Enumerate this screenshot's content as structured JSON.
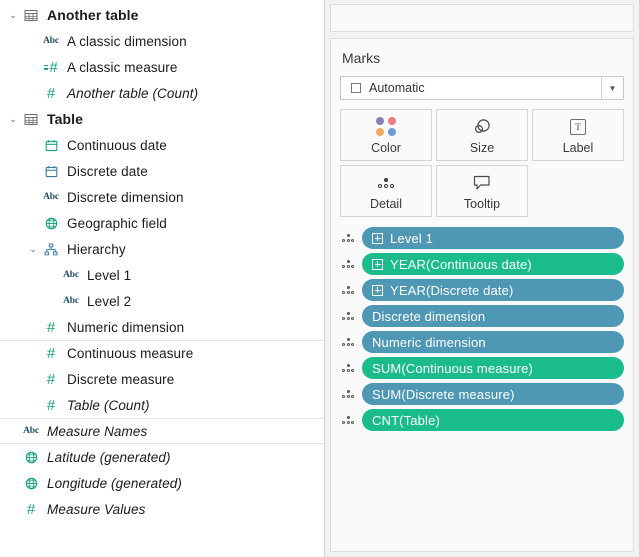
{
  "colors": {
    "pill_blue": "#4e97b5",
    "pill_green": "#1abc8b",
    "icon_green": "#17a07e",
    "icon_blue": "#3b7ea1",
    "text": "#1b1b1b"
  },
  "data_pane": {
    "groups": [
      {
        "name": "Another table",
        "icon": "table-icon",
        "expanded": true,
        "fields": [
          {
            "label": "A classic dimension",
            "icon": "abc-icon",
            "italic": false,
            "indent": 2
          },
          {
            "label": "A classic measure",
            "icon": "continuous-number-icon",
            "italic": false,
            "indent": 2
          },
          {
            "label": "Another table (Count)",
            "icon": "number-icon",
            "italic": true,
            "indent": 2
          }
        ]
      },
      {
        "name": "Table",
        "icon": "table-icon",
        "expanded": true,
        "fields": [
          {
            "label": "Continuous date",
            "icon": "calendar-green-icon",
            "italic": false,
            "indent": 2
          },
          {
            "label": "Discrete date",
            "icon": "calendar-blue-icon",
            "italic": false,
            "indent": 2
          },
          {
            "label": "Discrete dimension",
            "icon": "abc-icon",
            "italic": false,
            "indent": 2
          },
          {
            "label": "Geographic field",
            "icon": "globe-icon",
            "italic": false,
            "indent": 2
          },
          {
            "label": "Hierarchy",
            "icon": "hierarchy-icon",
            "italic": false,
            "indent": 2,
            "expandable": true,
            "expanded": true
          },
          {
            "label": "Level 1",
            "icon": "abc-icon",
            "italic": false,
            "indent": 3
          },
          {
            "label": "Level 2",
            "icon": "abc-icon",
            "italic": false,
            "indent": 3
          },
          {
            "label": "Numeric dimension",
            "icon": "number-icon",
            "italic": false,
            "indent": 2
          },
          {
            "label": "Continuous measure",
            "icon": "number-icon",
            "italic": false,
            "indent": 2,
            "divider_above": true
          },
          {
            "label": "Discrete measure",
            "icon": "number-icon",
            "italic": false,
            "indent": 2
          },
          {
            "label": "Table (Count)",
            "icon": "number-icon",
            "italic": true,
            "indent": 2
          }
        ]
      }
    ],
    "generated": [
      {
        "label": "Measure Names",
        "icon": "abc-icon",
        "italic": true,
        "divider_below": true
      },
      {
        "label": "Latitude (generated)",
        "icon": "globe-icon",
        "italic": true
      },
      {
        "label": "Longitude (generated)",
        "icon": "globe-icon",
        "italic": true
      },
      {
        "label": "Measure Values",
        "icon": "number-icon",
        "italic": true
      }
    ]
  },
  "marks": {
    "title": "Marks",
    "mark_type": {
      "value": "Automatic",
      "icon": "square-outline-icon",
      "caret": "chevron-down-icon"
    },
    "properties": [
      {
        "label": "Color",
        "icon": "color-dots-icon"
      },
      {
        "label": "Size",
        "icon": "size-circles-icon"
      },
      {
        "label": "Label",
        "icon": "label-text-icon"
      },
      {
        "label": "Detail",
        "icon": "detail-dots-icon"
      },
      {
        "label": "Tooltip",
        "icon": "tooltip-bubble-icon"
      }
    ],
    "pills": [
      {
        "label": "Level 1",
        "color": "blue",
        "expand": true
      },
      {
        "label": "YEAR(Continuous date)",
        "color": "green",
        "expand": true
      },
      {
        "label": "YEAR(Discrete date)",
        "color": "blue",
        "expand": true
      },
      {
        "label": "Discrete dimension",
        "color": "blue",
        "expand": false
      },
      {
        "label": "Numeric dimension",
        "color": "blue",
        "expand": false
      },
      {
        "label": "SUM(Continuous measure)",
        "color": "green",
        "expand": false
      },
      {
        "label": "SUM(Discrete measure)",
        "color": "blue",
        "expand": false
      },
      {
        "label": "CNT(Table)",
        "color": "green",
        "expand": false
      }
    ]
  }
}
